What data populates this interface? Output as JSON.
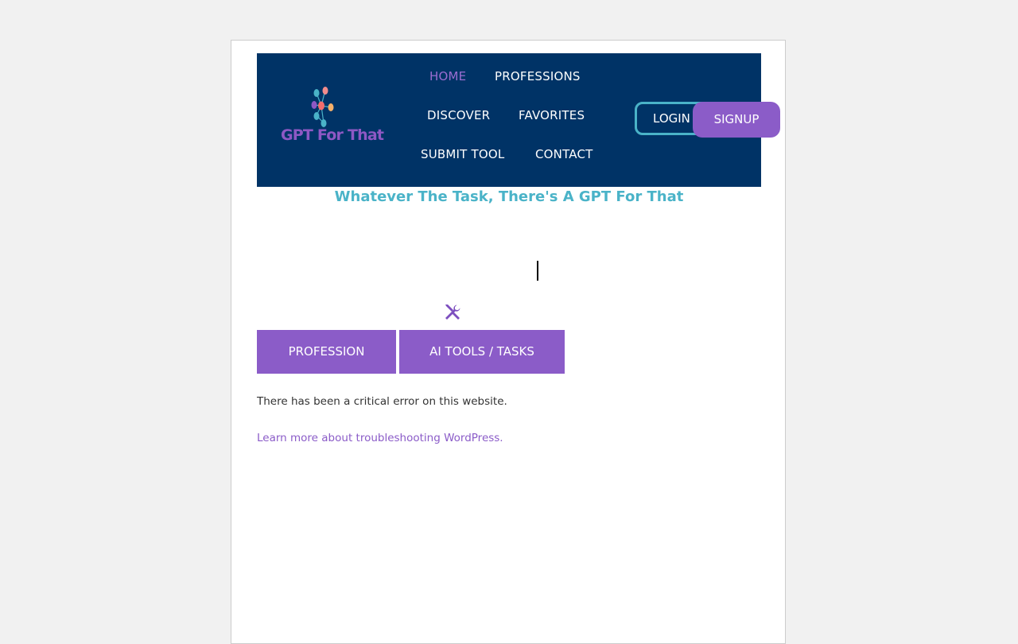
{
  "header": {
    "logo_text": "GPT For That",
    "nav": {
      "home": "HOME",
      "professions": "PROFESSIONS",
      "discover": "DISCOVER",
      "favorites": "FAVORITES",
      "submit_tool": "SUBMIT TOOL",
      "contact": "CONTACT"
    },
    "login_label": "LOGIN",
    "signup_label": "SIGNUP"
  },
  "tagline": "Whatever The Task, There's A GPT For That",
  "tabs": {
    "profession": "PROFESSION",
    "ai_tools": "AI TOOLS / TASKS"
  },
  "error": {
    "message": "There has been a critical error on this website.",
    "link": "Learn more about troubleshooting WordPress."
  },
  "colors": {
    "header_bg": "#003366",
    "accent_purple": "#8b5cc8",
    "accent_teal": "#4ab3c8",
    "page_bg": "#f1f1f1"
  },
  "icons": {
    "logo": "network-nodes-icon",
    "tools": "wrench-screwdriver-icon"
  }
}
